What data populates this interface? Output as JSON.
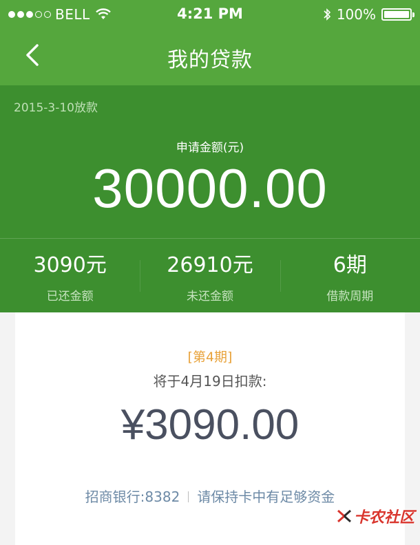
{
  "status_bar": {
    "carrier": "BELL",
    "time": "4:21 PM",
    "battery": "100%",
    "battery_level": 1.0,
    "signal_bars_filled": 3,
    "signal_bars_total": 5
  },
  "header": {
    "title": "我的贷款",
    "back_icon": "chevron-left-icon"
  },
  "summary": {
    "release_date": "2015-3-10放款",
    "apply_label": "申请金额(元)",
    "apply_amount": "30000.00",
    "stats": [
      {
        "value": "3090元",
        "label": "已还金额"
      },
      {
        "value": "26910元",
        "label": "未还金额"
      },
      {
        "value": "6期",
        "label": "借款周期"
      }
    ]
  },
  "repayment": {
    "period": "[第4期]",
    "note": "将于4月19日扣款:",
    "amount": "¥3090.00",
    "bank": "招商银行:8382",
    "reminder": "请保持卡中有足够资金"
  },
  "watermark": {
    "text": "卡农社区"
  },
  "colors": {
    "header_green": "#55a73d",
    "summary_green": "#3d8f2f",
    "period_orange": "#e8a23a",
    "amount_gray": "#4a5060",
    "bank_blue": "#6d8aa6",
    "watermark_red": "#d9352d"
  }
}
